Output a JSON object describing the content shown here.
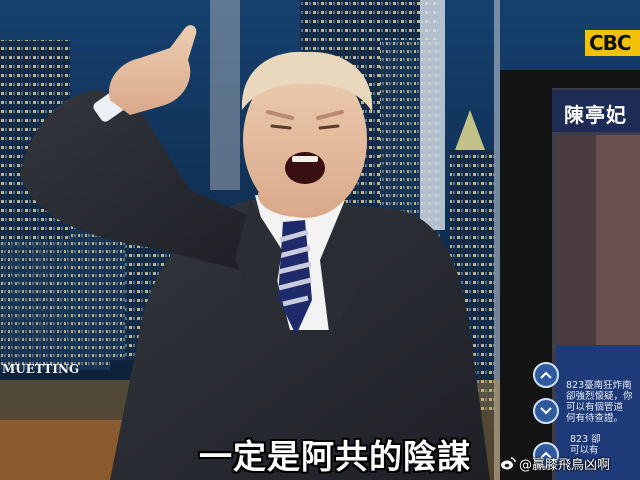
{
  "scene": {
    "channel_logo": "CBC",
    "background_sign": "MUETTING",
    "monitor": {
      "title": "陳亭妃",
      "ticker_line_1": "823臺南狂炸南",
      "ticker_line_2": "卻強烈懷疑，你",
      "ticker_line_3": "可以有個管道",
      "ticker_line_4": "何有待查證。",
      "ticker_line_5": "823  卻",
      "ticker_line_6": "可以有"
    },
    "subtitle": "一定是阿共的陰謀",
    "watermark": "@贏膝飛鳥凶啊"
  },
  "colors": {
    "suit": "#2a2c33",
    "shirt": "#f3f3f3",
    "tie_stripe_dark": "#1f2a6b",
    "tie_stripe_light": "#c9ccdb",
    "skin": "#e9c7a6",
    "hair": "#e9d8bd",
    "logo_yellow": "#f2c200",
    "monitor_frame": "#141414",
    "monitor_blue": "#2f5b9e"
  }
}
